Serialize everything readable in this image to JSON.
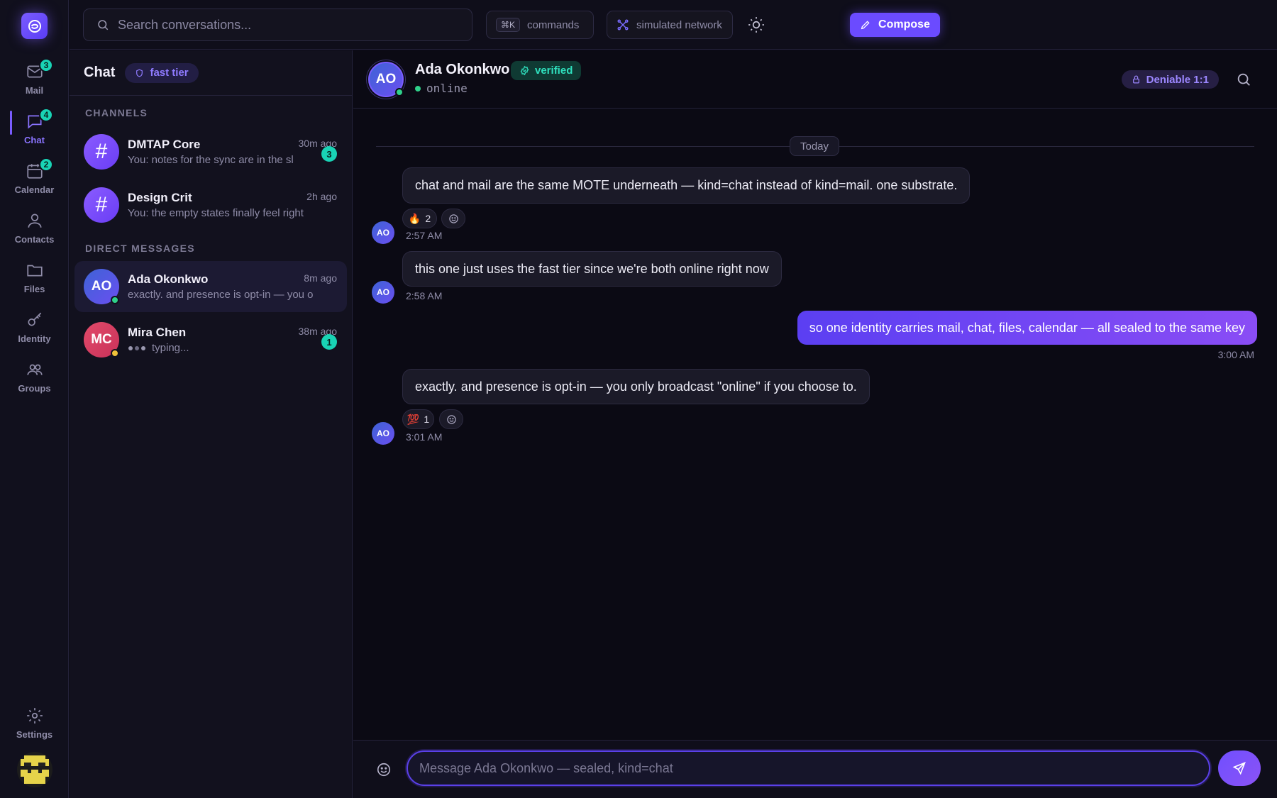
{
  "app": {
    "brand_color": "#6b4bff",
    "accent_teal": "#19d3b5"
  },
  "rail": {
    "items": [
      {
        "label": "Mail",
        "badge": "3",
        "icon": "mail-icon"
      },
      {
        "label": "Chat",
        "badge": "4",
        "icon": "chat-icon",
        "active": true
      },
      {
        "label": "Calendar",
        "badge": "2",
        "icon": "calendar-icon"
      },
      {
        "label": "Contacts",
        "badge": "",
        "icon": "person-icon"
      },
      {
        "label": "Files",
        "badge": "",
        "icon": "folder-icon"
      },
      {
        "label": "Identity",
        "badge": "",
        "icon": "key-icon"
      },
      {
        "label": "Groups",
        "badge": "",
        "icon": "people-icon"
      }
    ],
    "settings_label": "Settings"
  },
  "topbar": {
    "search_placeholder": "Search conversations...",
    "kbd": "⌘K",
    "commands_label": "commands",
    "network_label": "simulated network",
    "compose_label": "Compose"
  },
  "list": {
    "title": "Chat",
    "tier_label": "fast tier",
    "channels_label": "CHANNELS",
    "dms_label": "DIRECT MESSAGES",
    "channels": [
      {
        "name": "DMTAP Core",
        "time": "30m ago",
        "preview": "You: notes for the sync are in the sl",
        "count": "3"
      },
      {
        "name": "Design Crit",
        "time": "2h ago",
        "preview": "You: the empty states finally feel right",
        "count": ""
      }
    ],
    "dms": [
      {
        "initials": "AO",
        "name": "Ada Okonkwo",
        "time": "8m ago",
        "preview": "exactly. and presence is opt-in — you or",
        "count": "",
        "status": "online"
      },
      {
        "initials": "MC",
        "name": "Mira Chen",
        "time": "38m ago",
        "preview": "typing...",
        "count": "1",
        "status": "away"
      }
    ]
  },
  "chat": {
    "contact_initials": "AO",
    "contact_name": "Ada Okonkwo",
    "verified_label": "verified",
    "status": "online",
    "deniable_label": "Deniable 1:1",
    "day_label": "Today",
    "messages": [
      {
        "dir": "in",
        "text": "chat and mail are the same MOTE underneath — kind=chat instead of kind=mail. one substrate.",
        "time": "2:57 AM",
        "reaction": "🔥",
        "reaction_count": "2"
      },
      {
        "dir": "in",
        "text": "this one just uses the fast tier since we're both online right now",
        "time": "2:58 AM"
      },
      {
        "dir": "out",
        "text": "so one identity carries mail, chat, files, calendar — all sealed to the same key",
        "time": "3:00 AM"
      },
      {
        "dir": "in",
        "text": "exactly. and presence is opt-in — you only broadcast \"online\" if you choose to.",
        "time": "3:01 AM",
        "reaction": "💯",
        "reaction_count": "1"
      }
    ],
    "composer_placeholder": "Message Ada Okonkwo — sealed, kind=chat"
  }
}
